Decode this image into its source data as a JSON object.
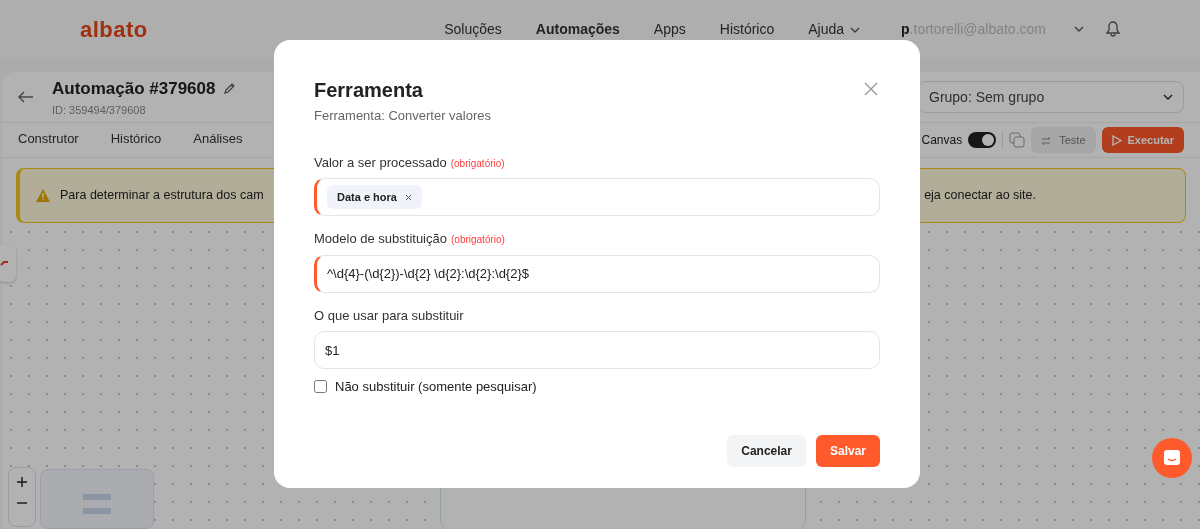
{
  "header": {
    "logo": "albato",
    "nav": [
      {
        "label": "Soluções",
        "selected": false,
        "dropdown": false
      },
      {
        "label": "Automações",
        "selected": true,
        "dropdown": false
      },
      {
        "label": "Apps",
        "selected": false,
        "dropdown": false
      },
      {
        "label": "Histórico",
        "selected": false,
        "dropdown": false
      },
      {
        "label": "Ajuda",
        "selected": false,
        "dropdown": true
      }
    ],
    "user": "p.tortorelli@albato.com"
  },
  "automation": {
    "title": "Automação #379608",
    "id": "ID: 359494/379608",
    "group": "Grupo: Sem grupo",
    "tabs": [
      {
        "label": "Construtor",
        "selected": false
      },
      {
        "label": "Histórico",
        "selected": false
      },
      {
        "label": "Análises",
        "selected": false
      }
    ],
    "canvas_toggle": {
      "label": "Canvas",
      "on": true
    },
    "buttons": [
      {
        "label": "Teste",
        "kind": "secondary"
      },
      {
        "label": "Executar",
        "kind": "primary"
      }
    ]
  },
  "alert": {
    "text_start": "Para determinar a estrutura dos cam",
    "text_end": "eja conectar ao site."
  },
  "modal": {
    "title": "Ferramenta",
    "subtitle": "Ferramenta: Converter valores",
    "fields": [
      {
        "label": "Valor a ser processado",
        "note": "(obrigatório)",
        "required": true,
        "kind": "tags",
        "tags": [
          "Data e hora"
        ]
      },
      {
        "label": "Modelo de substituição",
        "note": "(obrigatório)",
        "required": true,
        "kind": "text",
        "value": "^\\d{4}-(\\d{2})-\\d{2} \\d{2}:\\d{2}:\\d{2}$"
      },
      {
        "label": "O que usar para substituir",
        "required": false,
        "kind": "text",
        "value": "$1"
      }
    ],
    "checkbox": {
      "label": "Não substituir (somente pesquisar)",
      "checked": false
    },
    "buttons": [
      {
        "label": "Cancelar",
        "kind": "secondary"
      },
      {
        "label": "Salvar",
        "kind": "primary"
      }
    ]
  }
}
